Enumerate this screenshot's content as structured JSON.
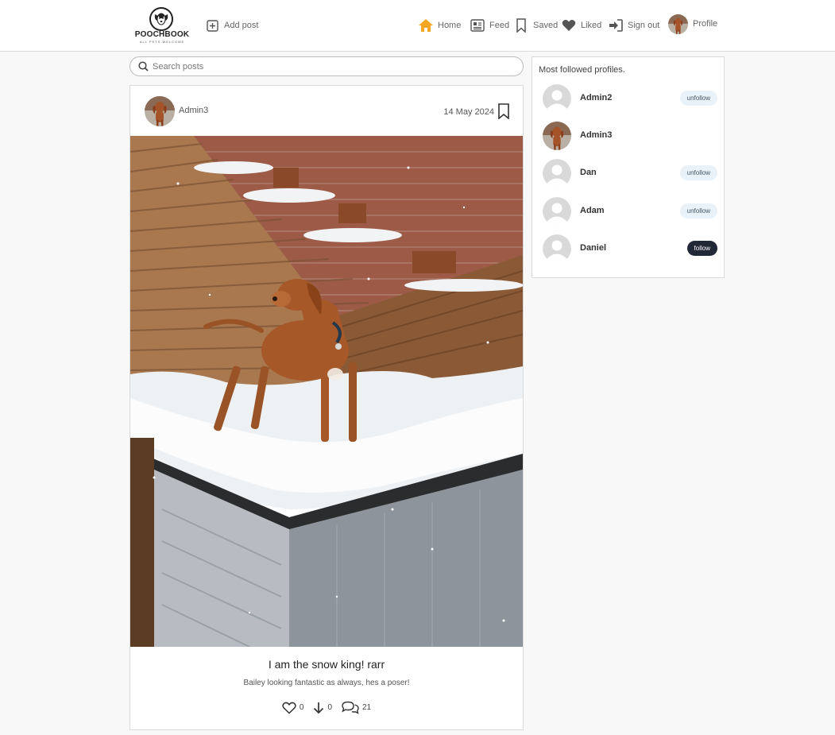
{
  "brand": {
    "name": "POOCHBOOK",
    "tagline": "ALL PETS WELCOME"
  },
  "nav": {
    "add_post": "Add post",
    "home": "Home",
    "feed": "Feed",
    "saved": "Saved",
    "liked": "Liked",
    "sign_out": "Sign out",
    "profile": "Profile"
  },
  "colors": {
    "home_accent": "#f5a623",
    "follow_button": "#212838",
    "unfollow_button": "#eaf2f9"
  },
  "search": {
    "placeholder": "Search posts",
    "value": ""
  },
  "post": {
    "author": "Admin3",
    "date": "14 May 2024",
    "title": "I am the snow king! rarr",
    "description": "Bailey looking fantastic as always, hes a poser!",
    "likes": "0",
    "downs": "0",
    "comments": "21"
  },
  "sidebar": {
    "title": "Most followed profiles.",
    "profiles": [
      {
        "name": "Admin2",
        "button": "unfollow",
        "avatar": "default"
      },
      {
        "name": "Admin3",
        "button": "",
        "avatar": "dog"
      },
      {
        "name": "Dan",
        "button": "unfollow",
        "avatar": "default"
      },
      {
        "name": "Adam",
        "button": "unfollow",
        "avatar": "default"
      },
      {
        "name": "Daniel",
        "button": "follow",
        "avatar": "default"
      }
    ]
  }
}
